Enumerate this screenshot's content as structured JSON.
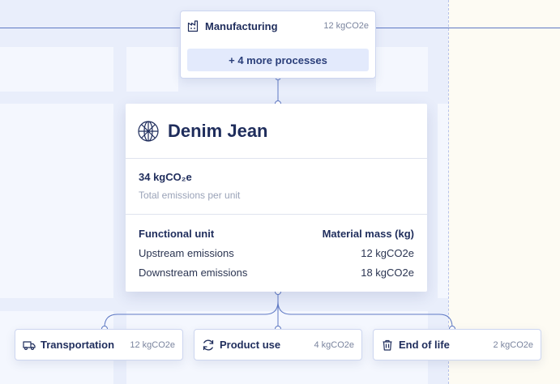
{
  "top_process": {
    "title": "Manufacturing",
    "value": "12 kgCO2e",
    "more_label": "+ 4 more processes",
    "icon": "factory-icon"
  },
  "product": {
    "name": "Denim Jean",
    "icon": "globe-icon",
    "total_emissions": "34 kgCO₂e",
    "total_emissions_label": "Total emissions per unit",
    "functional_unit_label": "Functional unit",
    "functional_unit_value": "Material mass (kg)",
    "upstream_label": "Upstream emissions",
    "upstream_value": "12 kgCO2e",
    "downstream_label": "Downstream emissions",
    "downstream_value": "18 kgCO2e"
  },
  "downstream": [
    {
      "label": "Transportation",
      "value": "12 kgCO2e",
      "icon": "truck-icon"
    },
    {
      "label": "Product use",
      "value": "4 kgCO2e",
      "icon": "refresh-icon"
    },
    {
      "label": "End of life",
      "value": "2 kgCO2e",
      "icon": "trash-icon"
    }
  ],
  "colors": {
    "accent": "#5f79c4",
    "text_primary": "#1f2d5c",
    "text_muted": "#9aa3b8",
    "canvas": "#e9eefb",
    "right_pane": "#fdfbf3"
  }
}
